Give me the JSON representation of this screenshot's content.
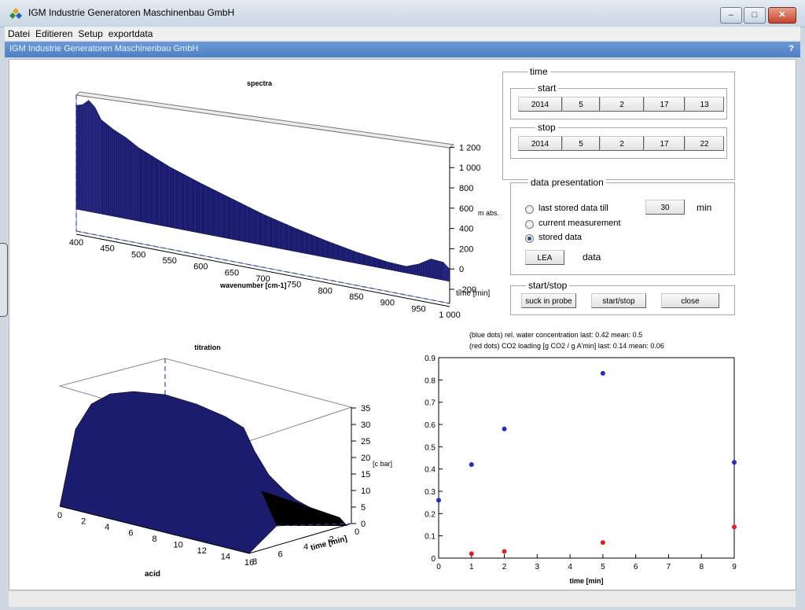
{
  "window": {
    "title": "IGM Industrie Generatoren Maschinenbau GmbH",
    "minimize": "–",
    "restore": "□",
    "close": "✕"
  },
  "menu": [
    "Datei",
    "Editieren",
    "Setup",
    "exportdata"
  ],
  "subheader": {
    "title": "IGM Industrie Generatoren Maschinenbau GmbH",
    "help": "?"
  },
  "time_panel": {
    "label": "time",
    "start": {
      "label": "start",
      "fields": [
        "2014",
        "5",
        "2",
        "17",
        "13"
      ]
    },
    "stop": {
      "label": "stop",
      "fields": [
        "2014",
        "5",
        "2",
        "17",
        "22"
      ]
    }
  },
  "presentation": {
    "label": "data presentation",
    "options": [
      "last stored data till",
      "current measurement",
      "stored data"
    ],
    "selected": 2,
    "minutes": "30",
    "minutes_unit": "min",
    "lea_button": "LEA",
    "lea_label": "data"
  },
  "startstop": {
    "label": "start/stop",
    "buttons": [
      "suck in probe",
      "start/stop",
      "close"
    ]
  },
  "colors": {
    "surface": "#1c1c6e",
    "blue_dots": "#1f2fc4",
    "red_dots": "#e02020"
  },
  "chart_data": [
    {
      "type": "area",
      "title": "spectra",
      "xlabel": "wavenumber [cm-1]",
      "ylabel": "time [min]",
      "zlabel": "m abs.",
      "x_ticks": [
        "400",
        "450",
        "500",
        "550",
        "600",
        "650",
        "700",
        "750",
        "800",
        "850",
        "900",
        "950",
        "1 000"
      ],
      "z_ticks": [
        "-200",
        "0",
        "200",
        "400",
        "600",
        "800",
        "1 000",
        "1 200"
      ],
      "xlim": [
        400,
        1000
      ],
      "zlim": [
        -200,
        1200
      ],
      "x": [
        400,
        410,
        420,
        430,
        440,
        460,
        480,
        500,
        550,
        600,
        650,
        700,
        750,
        800,
        850,
        900,
        930,
        950,
        970,
        990,
        1000
      ],
      "values": [
        1100,
        1120,
        1180,
        1120,
        1000,
        920,
        860,
        780,
        640,
        530,
        430,
        330,
        250,
        180,
        120,
        80,
        70,
        120,
        200,
        190,
        130
      ]
    },
    {
      "type": "area",
      "title": "titration",
      "xlabel": "acid",
      "ylabel": "time [min]",
      "zlabel": "[c bar]",
      "x_ticks": [
        "0",
        "2",
        "4",
        "6",
        "8",
        "10",
        "12",
        "14",
        "16"
      ],
      "y_ticks": [
        "8",
        "6",
        "4",
        "2",
        "0"
      ],
      "z_ticks": [
        "0",
        "5",
        "10",
        "15",
        "20",
        "25",
        "30",
        "35"
      ],
      "xlim": [
        0,
        16
      ],
      "ylim": [
        8,
        0
      ],
      "zlim": [
        0,
        35
      ]
    },
    {
      "type": "scatter",
      "title_lines": [
        "(blue dots)  rel. water concentration    last:  0.42  mean:  0.5",
        "(red dots) CO2 loading [g CO2 / g A'min] last:  0.14  mean:  0.06"
      ],
      "xlabel": "time [min]",
      "xlim": [
        0,
        9
      ],
      "ylim": [
        0,
        0.9
      ],
      "x_ticks": [
        "0",
        "1",
        "2",
        "3",
        "4",
        "5",
        "6",
        "7",
        "8",
        "9"
      ],
      "y_ticks": [
        "0",
        "0.1",
        "0.2",
        "0.3",
        "0.4",
        "0.5",
        "0.6",
        "0.7",
        "0.8",
        "0.9"
      ],
      "series": [
        {
          "x": [
            0,
            1,
            2,
            5,
            9
          ],
          "y": [
            0.26,
            0.42,
            0.58,
            0.83,
            0.43
          ]
        },
        {
          "x": [
            1,
            2,
            5,
            9
          ],
          "y": [
            0.02,
            0.03,
            0.07,
            0.14
          ]
        }
      ]
    }
  ]
}
